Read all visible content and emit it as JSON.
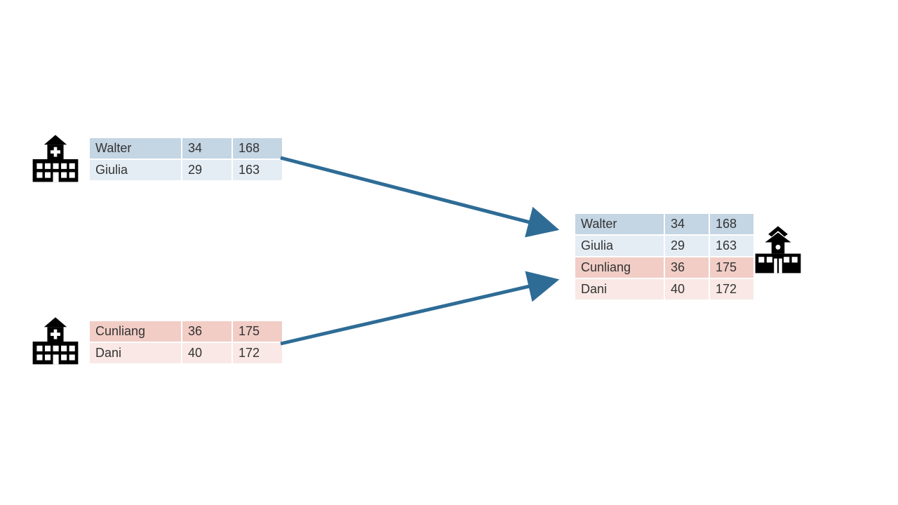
{
  "chart_data": {
    "type": "table",
    "source_tables": [
      {
        "color": "blue",
        "rows": [
          {
            "name": "Walter",
            "col2": 34,
            "col3": 168
          },
          {
            "name": "Giulia",
            "col2": 29,
            "col3": 163
          }
        ]
      },
      {
        "color": "red",
        "rows": [
          {
            "name": "Cunliang",
            "col2": 36,
            "col3": 175
          },
          {
            "name": "Dani",
            "col2": 40,
            "col3": 172
          }
        ]
      }
    ],
    "merged_table": {
      "rows": [
        {
          "name": "Walter",
          "col2": 34,
          "col3": 168,
          "color": "blue"
        },
        {
          "name": "Giulia",
          "col2": 29,
          "col3": 163,
          "color": "blue"
        },
        {
          "name": "Cunliang",
          "col2": 36,
          "col3": 175,
          "color": "red"
        },
        {
          "name": "Dani",
          "col2": 40,
          "col3": 172,
          "color": "red"
        }
      ]
    },
    "arrow_color": "#2e6c96"
  },
  "icons": {
    "hospital": "hospital-icon",
    "institution": "institution-icon"
  }
}
